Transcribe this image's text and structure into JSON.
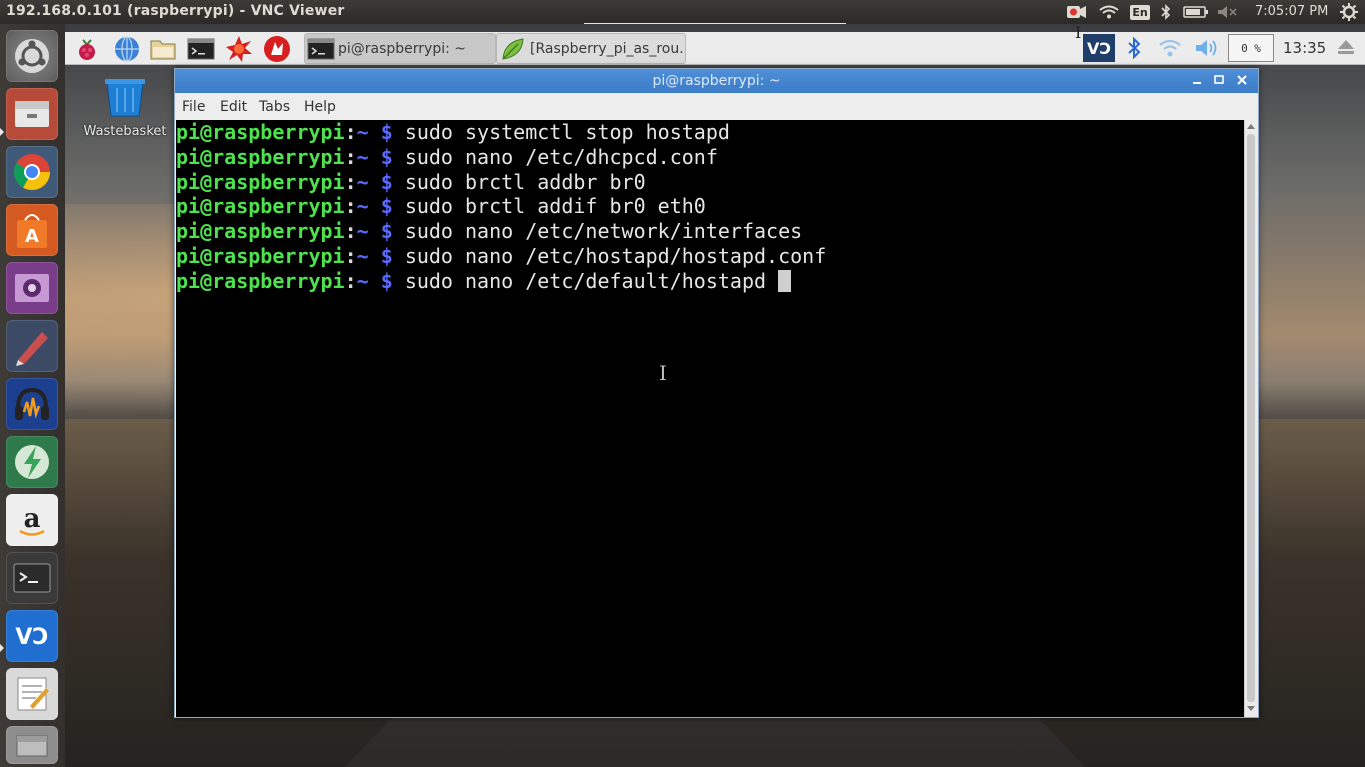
{
  "host": {
    "window_title": "192.168.0.101 (raspberrypi) - VNC Viewer",
    "clock": "7:05:07 PM",
    "language": "En",
    "launcher": [
      {
        "name": "ubuntu-dash"
      },
      {
        "name": "files"
      },
      {
        "name": "chrome"
      },
      {
        "name": "software-center"
      },
      {
        "name": "video-player"
      },
      {
        "name": "markup-tool"
      },
      {
        "name": "audacity"
      },
      {
        "name": "power-tool"
      },
      {
        "name": "amazon"
      },
      {
        "name": "terminal"
      },
      {
        "name": "vnc-viewer"
      },
      {
        "name": "text-editor"
      },
      {
        "name": "archive"
      }
    ]
  },
  "pi": {
    "taskbar": [
      {
        "label": "pi@raspberrypi: ~",
        "icon": "terminal-icon",
        "active": true
      },
      {
        "label": "[Raspberry_pi_as_rou...",
        "icon": "leafpad-icon",
        "active": false
      }
    ],
    "cpu_usage": "0 %",
    "clock": "13:35",
    "desktop_icons": [
      {
        "label": "Wastebasket"
      }
    ],
    "terminal": {
      "title": "pi@raspberrypi: ~",
      "menu": [
        "File",
        "Edit",
        "Tabs",
        "Help"
      ],
      "prompt_user": "pi@raspberrypi",
      "prompt_path": "~",
      "prompt_symbol": "$",
      "lines": [
        "sudo systemctl stop hostapd",
        "sudo nano /etc/dhcpcd.conf",
        "sudo brctl addbr br0",
        "sudo brctl addif br0 eth0",
        "sudo nano /etc/network/interfaces",
        "sudo nano /etc/hostapd/hostapd.conf",
        "sudo nano /etc/default/hostapd "
      ]
    }
  },
  "colors": {
    "prompt_user": "#4ee24e",
    "prompt_path": "#5a6bff",
    "titlebar": "#4586d0"
  }
}
